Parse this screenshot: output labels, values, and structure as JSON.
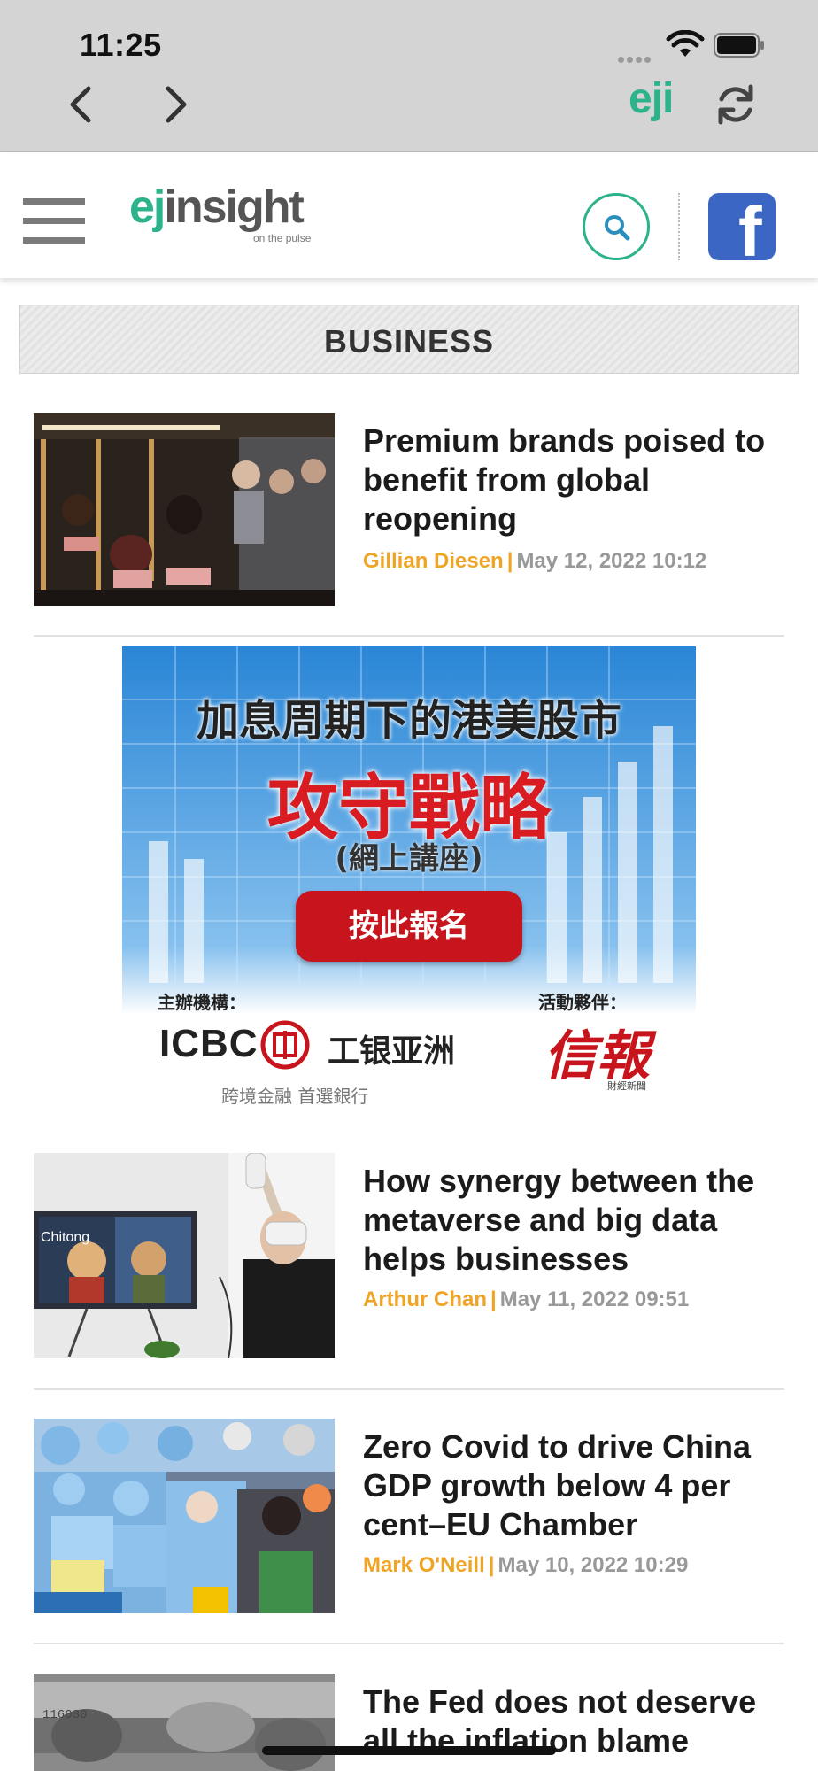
{
  "status_bar": {
    "time": "11:25"
  },
  "browser": {
    "site_mini_logo": "eji"
  },
  "header": {
    "logo_eji": "ej",
    "logo_insight": "insight",
    "logo_tagline": "on the pulse"
  },
  "section": {
    "title": "BUSINESS"
  },
  "articles": [
    {
      "headline": "Premium brands poised to benefit from global reopening",
      "author": "Gillian Diesen",
      "separator": "|",
      "date": "May 12, 2022 10:12"
    },
    {
      "headline": "How synergy between the metaverse and big data helps businesses",
      "author": "Arthur Chan",
      "separator": "|",
      "date": "May 11, 2022 09:51"
    },
    {
      "headline": "Zero Covid to drive China GDP growth below 4 per cent–EU Chamber",
      "author": "Mark O'Neill",
      "separator": "|",
      "date": "May 10, 2022 10:29"
    },
    {
      "headline": "The Fed does not deserve all the inflation blame",
      "author": "",
      "separator": "",
      "date": ""
    }
  ],
  "ad": {
    "headline": "加息周期下的港美股市",
    "title": "攻守戰略",
    "subtitle": "(網上講座)",
    "cta": "按此報名",
    "organizer_label": "主辦機構：",
    "partner_label": "活動夥伴：",
    "icbc_en": "ICBC",
    "icbc_cn": "工银亚洲",
    "icbc_tagline": "跨境金融 首選銀行",
    "partner_logo": "信報",
    "partner_sub": "財經新聞"
  },
  "colors": {
    "accent_green": "#2db38c",
    "author_orange": "#f0a425",
    "facebook_blue": "#3b66c4",
    "ad_red": "#c8141c"
  }
}
